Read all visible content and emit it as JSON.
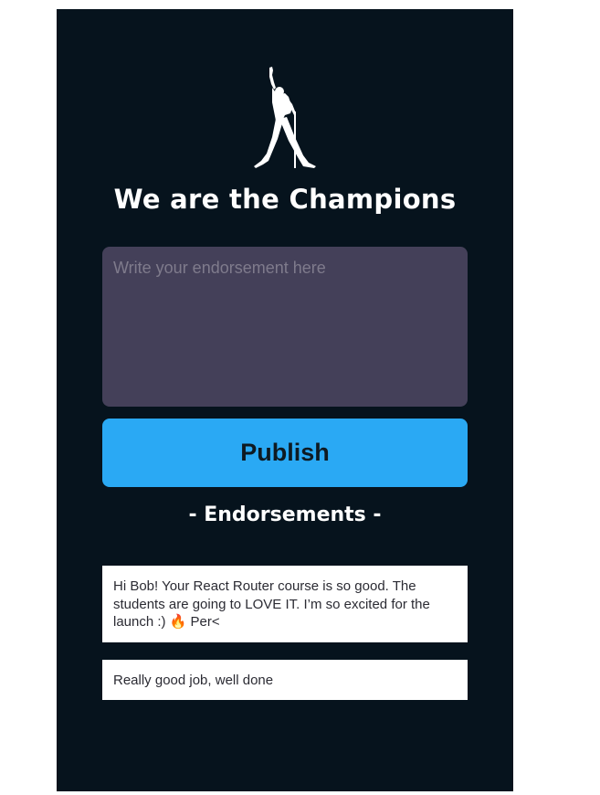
{
  "header": {
    "title": "We are the Champions"
  },
  "form": {
    "endorsement_placeholder": "Write your endorsement here",
    "publish_label": "Publish"
  },
  "endorsements": {
    "heading": "- Endorsements -",
    "items": [
      {
        "text": "Hi Bob! Your React Router course is so good. The students are going to LOVE IT. I’m so excited for the launch :) 🔥 Per<"
      },
      {
        "text": "Really good job, well done"
      }
    ]
  },
  "colors": {
    "app_background": "#06131d",
    "input_background": "#444059",
    "publish_button": "#2aa9f4",
    "card_background": "#ffffff"
  },
  "icons": {
    "logo": "champion-silhouette-icon"
  }
}
